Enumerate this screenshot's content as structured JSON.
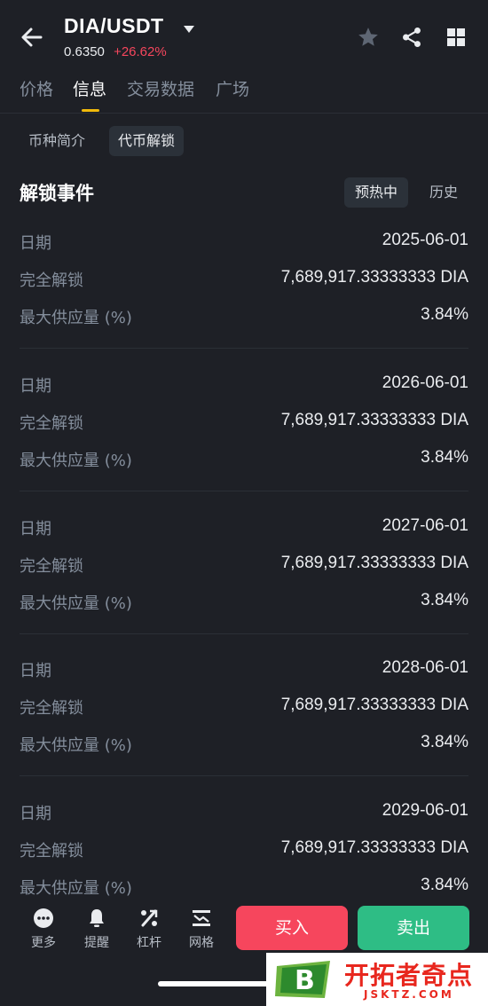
{
  "header": {
    "pair": "DIA/USDT",
    "price": "0.6350",
    "change": "+26.62%"
  },
  "tabs": [
    "价格",
    "信息",
    "交易数据",
    "广场"
  ],
  "subtabs": [
    "币种简介",
    "代币解锁"
  ],
  "section": {
    "title": "解锁事件",
    "filters": [
      "预热中",
      "历史"
    ]
  },
  "events": [
    {
      "date_label": "日期",
      "date": "2025-06-01",
      "unlock_label": "完全解锁",
      "unlock": "7,689,917.33333333 DIA",
      "supply_label": "最大供应量 (%)",
      "supply": "3.84%"
    },
    {
      "date_label": "日期",
      "date": "2026-06-01",
      "unlock_label": "完全解锁",
      "unlock": "7,689,917.33333333 DIA",
      "supply_label": "最大供应量 (%)",
      "supply": "3.84%"
    },
    {
      "date_label": "日期",
      "date": "2027-06-01",
      "unlock_label": "完全解锁",
      "unlock": "7,689,917.33333333 DIA",
      "supply_label": "最大供应量 (%)",
      "supply": "3.84%"
    },
    {
      "date_label": "日期",
      "date": "2028-06-01",
      "unlock_label": "完全解锁",
      "unlock": "7,689,917.33333333 DIA",
      "supply_label": "最大供应量 (%)",
      "supply": "3.84%"
    },
    {
      "date_label": "日期",
      "date": "2029-06-01",
      "unlock_label": "完全解锁",
      "unlock": "7,689,917.33333333 DIA",
      "supply_label": "最大供应量 (%)",
      "supply": "3.84%"
    }
  ],
  "bottom": {
    "items": [
      "更多",
      "提醒",
      "杠杆",
      "网格"
    ],
    "buy": "买入",
    "sell": "卖出"
  },
  "watermark": {
    "logo_letter": "B",
    "name": "开拓者奇点",
    "url": "JSKTZ.COM"
  },
  "colors": {
    "background": "#1e2026",
    "up": "#2ebd85",
    "down": "#f6465d",
    "accent": "#f0b90b"
  }
}
